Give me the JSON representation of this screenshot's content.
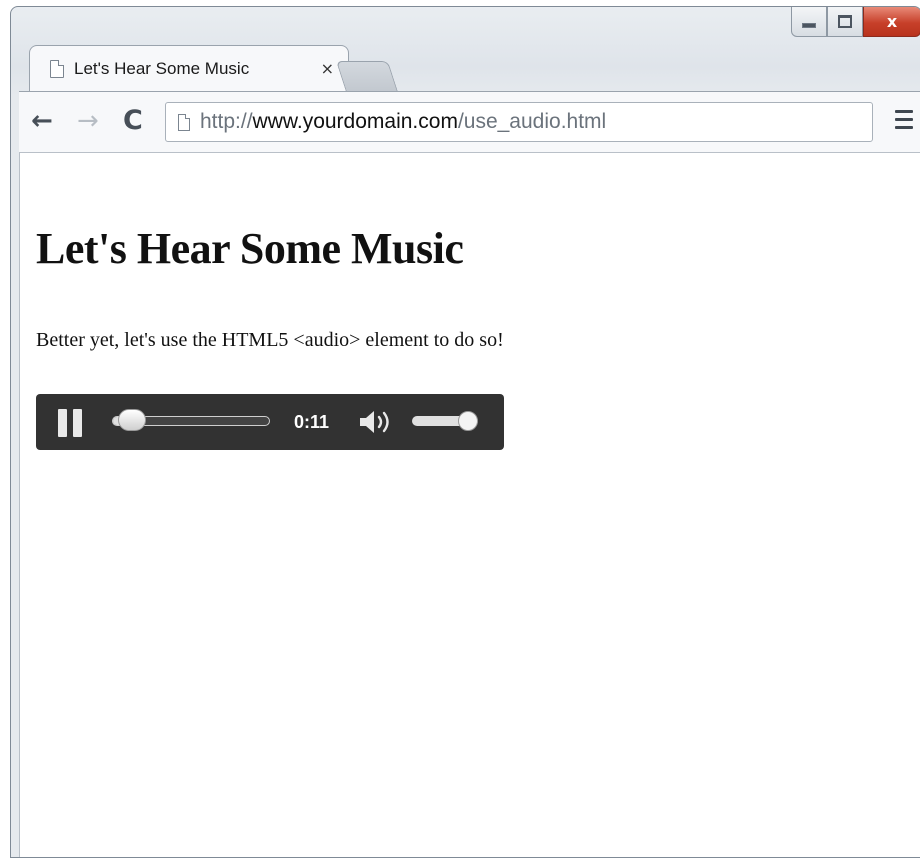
{
  "window": {
    "controls": {
      "minimize_icon": "minimize-icon",
      "maximize_icon": "maximize-icon",
      "close_label": "x"
    }
  },
  "tab": {
    "title": "Let's Hear Some Music",
    "close_label": "×"
  },
  "toolbar": {
    "back_glyph": "←",
    "forward_glyph": "→",
    "reload_glyph": "C",
    "url": {
      "scheme": "http://",
      "host": "www.yourdomain.com",
      "path": "/use_audio.html"
    }
  },
  "page": {
    "heading": "Let's Hear Some Music",
    "paragraph": "Better yet, let's use the HTML5 <audio> element to do so!"
  },
  "audio_player": {
    "state": "playing",
    "time": "0:11",
    "progress_fraction": 0.12,
    "volume_fraction": 0.85,
    "accent": "#323232"
  }
}
